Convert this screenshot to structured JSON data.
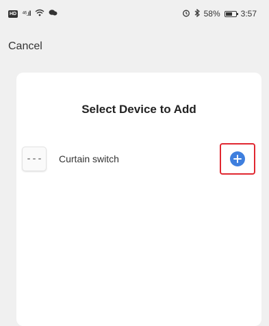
{
  "status_bar": {
    "hd": "HD",
    "signal": "⁴⁶.ıll",
    "battery_percent": "58%",
    "time": "3:57",
    "battery_level": 0.58
  },
  "nav": {
    "cancel_label": "Cancel"
  },
  "dialog": {
    "title": "Select Device to Add",
    "devices": [
      {
        "name": "Curtain switch",
        "icon": "curtain-switch-icon",
        "action_icon": "plus-circle-icon"
      }
    ]
  },
  "colors": {
    "background": "#f0f0f0",
    "card": "#ffffff",
    "accent_blue": "#3f7fde",
    "highlight_red": "#e0262f"
  }
}
